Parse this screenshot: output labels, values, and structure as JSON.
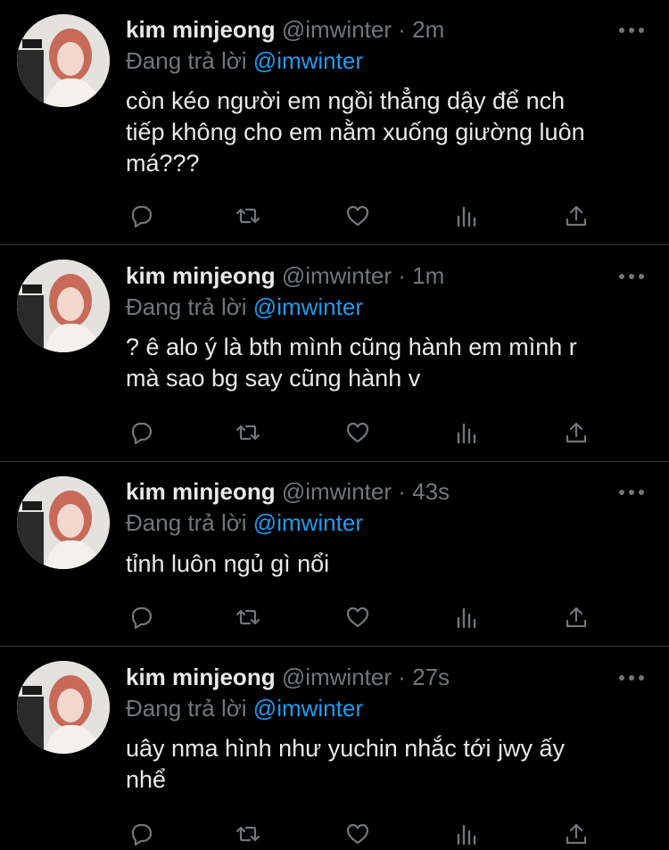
{
  "theme": {
    "background": "#000000",
    "text_primary": "#e7e9ea",
    "text_secondary": "#71767b",
    "link": "#1d9bf0",
    "divider": "#2f3336"
  },
  "tweets": [
    {
      "name": "kim minjeong",
      "handle": "@imwinter",
      "dot": "·",
      "time": "2m",
      "reply_prefix": "Đang trả lời",
      "reply_handle": "@imwinter",
      "lines": [
        "còn kéo người em ngồi thẳng dậy để nch",
        "tiếp không cho em nằm xuống giường luôn",
        "má???"
      ]
    },
    {
      "name": "kim minjeong",
      "handle": "@imwinter",
      "dot": "·",
      "time": "1m",
      "reply_prefix": "Đang trả lời",
      "reply_handle": "@imwinter",
      "lines": [
        "? ê alo ý là bth mình cũng hành em mình r",
        "mà sao bg say cũng hành v"
      ]
    },
    {
      "name": "kim minjeong",
      "handle": "@imwinter",
      "dot": "·",
      "time": "43s",
      "reply_prefix": "Đang trả lời",
      "reply_handle": "@imwinter",
      "lines": [
        "tỉnh luôn ngủ gì nổi"
      ]
    },
    {
      "name": "kim minjeong",
      "handle": "@imwinter",
      "dot": "·",
      "time": "27s",
      "reply_prefix": "Đang trả lời",
      "reply_handle": "@imwinter",
      "lines": [
        "uây nma hình như yuchin nhắc tới jwy ấy",
        "nhể"
      ]
    }
  ],
  "icons": {
    "more": "more-horizontal-icon",
    "reply": "reply-bubble-icon",
    "retweet": "retweet-icon",
    "like": "heart-icon",
    "views": "views-bar-chart-icon",
    "share": "share-upload-icon"
  }
}
